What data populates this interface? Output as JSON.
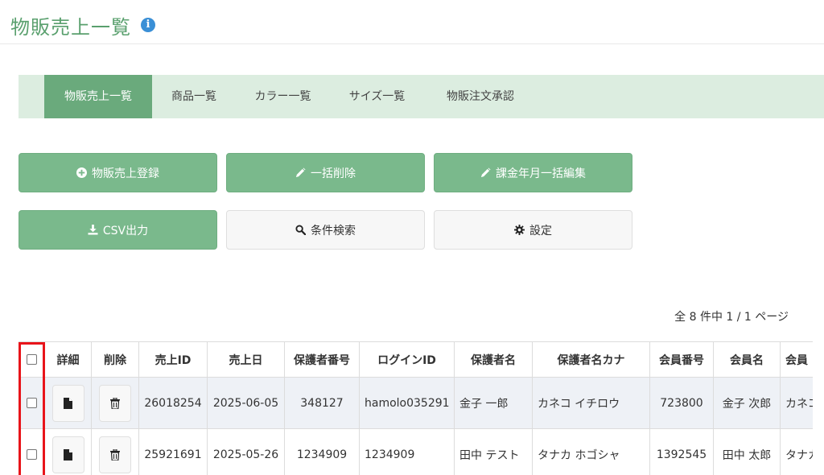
{
  "header": {
    "title": "物販売上一覧",
    "info_icon": "info-circle-icon"
  },
  "tabs": [
    {
      "label": "物販売上一覧",
      "active": true
    },
    {
      "label": "商品一覧",
      "active": false
    },
    {
      "label": "カラー一覧",
      "active": false
    },
    {
      "label": "サイズ一覧",
      "active": false
    },
    {
      "label": "物販注文承認",
      "active": false
    }
  ],
  "actions": {
    "register": {
      "label": "物販売上登録",
      "icon": "plus-circle-icon"
    },
    "bulk_delete": {
      "label": "一括削除",
      "icon": "pencil-icon"
    },
    "bulk_edit": {
      "label": "課金年月一括編集",
      "icon": "pencil-icon"
    },
    "csv": {
      "label": "CSV出力",
      "icon": "download-icon"
    },
    "search": {
      "label": "条件検索",
      "icon": "search-icon"
    },
    "settings": {
      "label": "設定",
      "icon": "gear-icon"
    }
  },
  "pagination": {
    "text": "全 8 件中 1 / 1 ページ"
  },
  "table": {
    "columns": [
      "詳細",
      "削除",
      "売上ID",
      "売上日",
      "保護者番号",
      "ログインID",
      "保護者名",
      "保護者名カナ",
      "会員番号",
      "会員名",
      "会員"
    ],
    "rows": [
      {
        "sales_id": "26018254",
        "date": "2025-06-05",
        "guardian_no": "348127",
        "login_id": "hamolo035291",
        "guardian_name": "金子 一郎",
        "guardian_kana": "カネコ イチロウ",
        "member_no": "723800",
        "member_name": "金子 次郎",
        "member_kana": "カネコ"
      },
      {
        "sales_id": "25921691",
        "date": "2025-05-26",
        "guardian_no": "1234909",
        "login_id": "1234909",
        "guardian_name": "田中 テスト",
        "guardian_kana": "タナカ ホゴシャ",
        "member_no": "1392545",
        "member_name": "田中 太郎",
        "member_kana": "タナカ"
      }
    ]
  },
  "colors": {
    "accent": "#7ab98c",
    "title": "#5aa06e",
    "highlight": "#e8141a"
  }
}
